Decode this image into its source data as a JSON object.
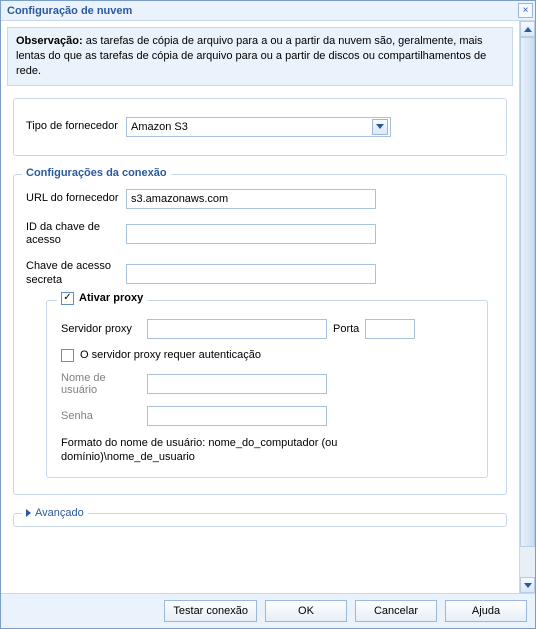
{
  "window": {
    "title": "Configuração de nuvem"
  },
  "note": {
    "bold": "Observação:",
    "text": " as tarefas de cópia de arquivo para a ou a partir da nuvem são, geralmente, mais lentas do que as tarefas de cópia de arquivo para ou a partir de discos ou compartilhamentos de rede."
  },
  "provider": {
    "label": "Tipo de fornecedor",
    "value": "Amazon S3"
  },
  "conn": {
    "legend": "Configurações da conexão",
    "url_label": "URL do fornecedor",
    "url_value": "s3.amazonaws.com",
    "access_id_label": "ID da chave de acesso",
    "access_id_value": "",
    "secret_label": "Chave de acesso secreta",
    "secret_value": ""
  },
  "proxy": {
    "enable_label": "Ativar proxy",
    "server_label": "Servidor proxy",
    "server_value": "",
    "port_label": "Porta",
    "port_value": "",
    "auth_label": "O servidor proxy requer autenticação",
    "user_label": "Nome de usuário",
    "user_value": "",
    "pass_label": "Senha",
    "pass_value": "",
    "hint": "Formato do nome de usuário: nome_do_computador (ou domínio)\\nome_de_usuario"
  },
  "advanced": {
    "legend": "Avançado"
  },
  "buttons": {
    "test": "Testar conexão",
    "ok": "OK",
    "cancel": "Cancelar",
    "help": "Ajuda"
  }
}
